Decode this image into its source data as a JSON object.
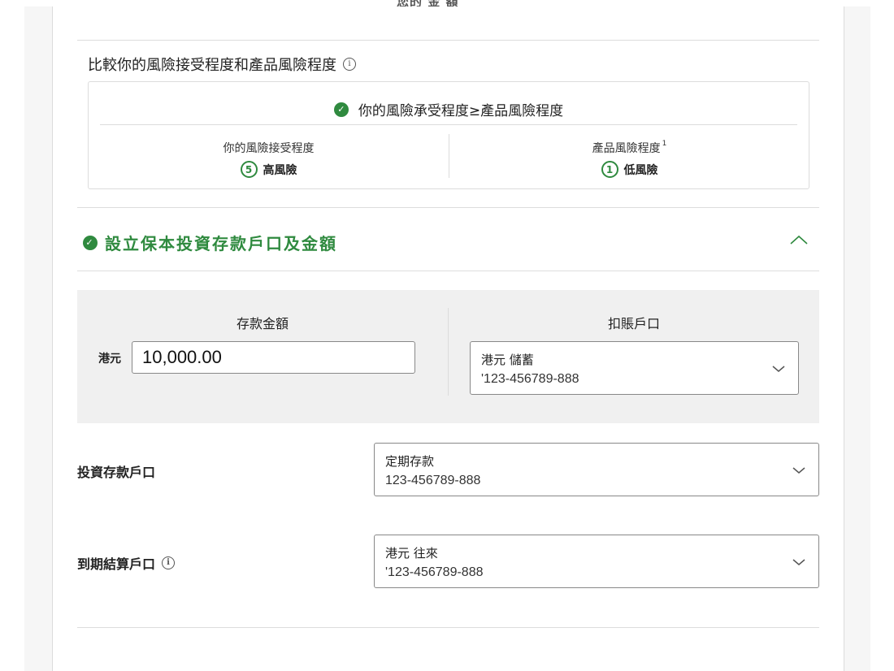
{
  "top_cut_text": "您的 金 額",
  "risk_compare": {
    "title": "比較你的風險接受程度和產品風險程度",
    "result": "你的風險承受程度≥產品風險程度",
    "your_label": "你的風險接受程度",
    "your_level": "5",
    "your_level_text": "高風險",
    "product_label": "產品風險程度",
    "product_sup": "1",
    "product_level": "1",
    "product_level_text": "低風險"
  },
  "section": {
    "title": "設立保本投資存款戶口及金額"
  },
  "deposit": {
    "amount_heading": "存款金額",
    "currency": "港元",
    "amount_value": "10,000.00",
    "debit_heading": "扣賬戶口",
    "debit_account_name": "港元 儲蓄",
    "debit_account_no": "'123-456789-888"
  },
  "investment_account": {
    "label": "投資存款戶口",
    "name": "定期存款",
    "number": "123-456789-888"
  },
  "maturity_account": {
    "label": "到期結算戶口",
    "name": "港元 往來",
    "number": "'123-456789-888"
  },
  "colors": {
    "accent_green": "#2f8a3f",
    "border": "#dcdcdc",
    "grey_bg": "#f0f0f0"
  },
  "icons": {
    "info": "info-circle-icon",
    "check": "check-circle-icon",
    "chevron_up": "chevron-up-icon",
    "chevron_down": "chevron-down-icon"
  }
}
